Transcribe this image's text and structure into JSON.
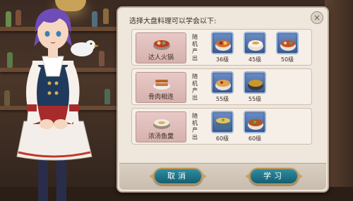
{
  "dialog": {
    "title": "选择大盘料理可以学会以下:",
    "close_label": "×",
    "random_label": "随机产出",
    "recipes": [
      {
        "name": "达人火锅",
        "icon": "hotpot-icon",
        "results": [
          {
            "icon": "meat-stew-bowl-icon",
            "level": "36级"
          },
          {
            "icon": "rice-bowl-icon",
            "level": "45级"
          },
          {
            "icon": "braised-meat-bowl-icon",
            "level": "50级"
          }
        ]
      },
      {
        "name": "骨肉相连",
        "icon": "skewers-icon",
        "results": [
          {
            "icon": "stew-bowl-icon",
            "level": "55级"
          },
          {
            "icon": "tea-soup-bowl-icon",
            "level": "55级"
          }
        ]
      },
      {
        "name": "浓汤鱼羹",
        "icon": "fish-soup-icon",
        "results": [
          {
            "icon": "stew-pot-icon",
            "level": "60级"
          },
          {
            "icon": "fried-dish-bowl-icon",
            "level": "60级"
          }
        ]
      }
    ],
    "cancel_label": "取消",
    "learn_label": "学习"
  }
}
